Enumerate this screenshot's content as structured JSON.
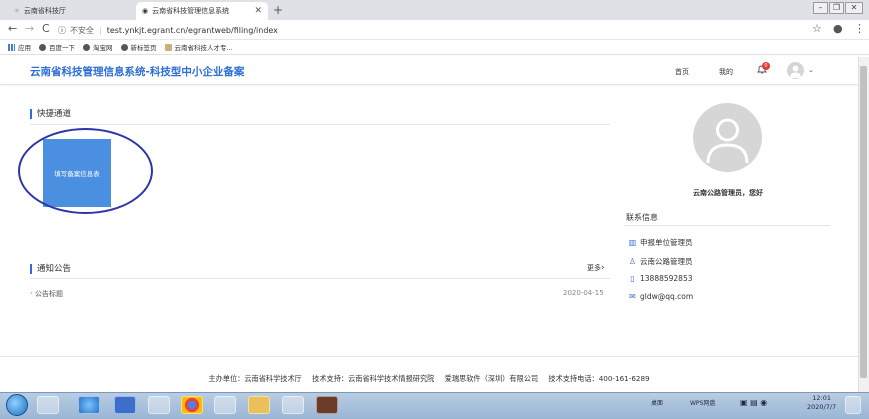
{
  "browser": {
    "tabs": [
      {
        "label": "云南省科技厅",
        "active": false
      },
      {
        "label": "云南省科技管理信息系统",
        "active": true
      }
    ],
    "security_label": "不安全",
    "url": "test.ynkjt.egrant.cn/egrantweb/filing/index",
    "bookmarks": [
      "应用",
      "百度一下",
      "淘宝网",
      "新标签页",
      "云南省科技人才专..."
    ]
  },
  "header": {
    "title": "云南省科技管理信息系统-科技型中小企业备案",
    "nav_home": "首页",
    "nav_mine": "我的",
    "notification_count": "0"
  },
  "quick": {
    "title": "快捷通道",
    "button_label": "填写备案信息表"
  },
  "notices": {
    "title": "通知公告",
    "more_label": "更多",
    "items": [
      {
        "title": "公告标题",
        "date": "2020-04-15"
      }
    ]
  },
  "profile": {
    "greeting": "云南公路管理员，您好",
    "contact_title": "联系信息",
    "org": "申报单位管理员",
    "name": "云南公路管理员",
    "phone": "13888592853",
    "email": "gldw@qq.com"
  },
  "footer": {
    "sponsor": "主办单位：云南省科学技术厅",
    "support": "技术支持：云南省科学技术情报研究院",
    "company": "爱瑞思软件（深圳）有限公司",
    "phone": "技术支持电话：400-161-6289"
  },
  "taskbar": {
    "desktop_label": "桌面",
    "wps_label": "WPS网盘",
    "time": "12:01",
    "date": "2020/7/7"
  },
  "colors": {
    "brand": "#2d6fd6",
    "button": "#4a8fe0",
    "annotation": "#2e35a8",
    "badge": "#e53935"
  }
}
